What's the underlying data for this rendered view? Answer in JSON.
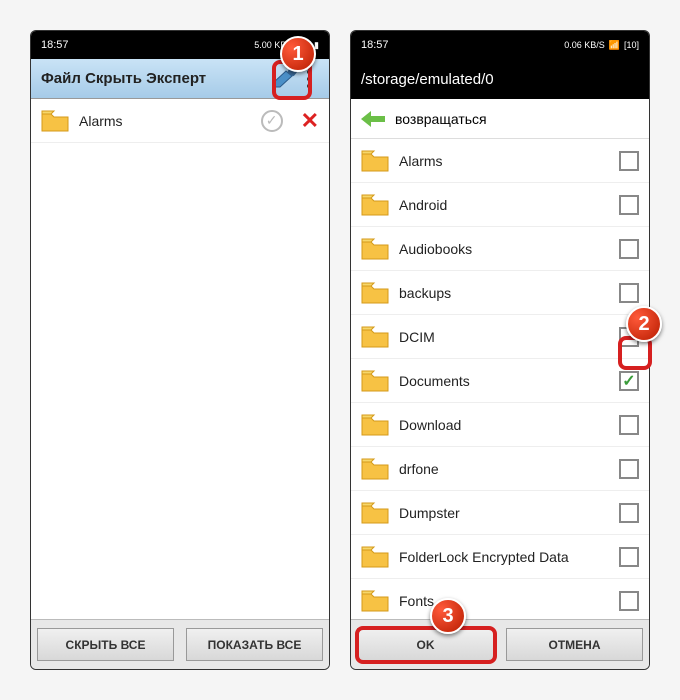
{
  "left": {
    "time": "18:57",
    "status": "5.00 KB/S",
    "title": "Файл Скрыть Эксперт",
    "item": "Alarms",
    "hide_all": "СКРЫТЬ ВСЕ",
    "show_all": "ПОКАЗАТЬ ВСЕ"
  },
  "right": {
    "time": "18:57",
    "status": "0.06 KB/S",
    "battery": "10",
    "path": "/storage/emulated/0",
    "back": "возвращаться",
    "folders": [
      {
        "name": "Alarms",
        "checked": false
      },
      {
        "name": "Android",
        "checked": false
      },
      {
        "name": "Audiobooks",
        "checked": false
      },
      {
        "name": "backups",
        "checked": false
      },
      {
        "name": "DCIM",
        "checked": false
      },
      {
        "name": "Documents",
        "checked": true
      },
      {
        "name": "Download",
        "checked": false
      },
      {
        "name": "drfone",
        "checked": false
      },
      {
        "name": "Dumpster",
        "checked": false
      },
      {
        "name": "FolderLock Encrypted Data",
        "checked": false
      },
      {
        "name": "Fonts",
        "checked": false
      }
    ],
    "ok": "OK",
    "cancel": "ОТМЕНА"
  },
  "callouts": {
    "c1": "1",
    "c2": "2",
    "c3": "3"
  }
}
